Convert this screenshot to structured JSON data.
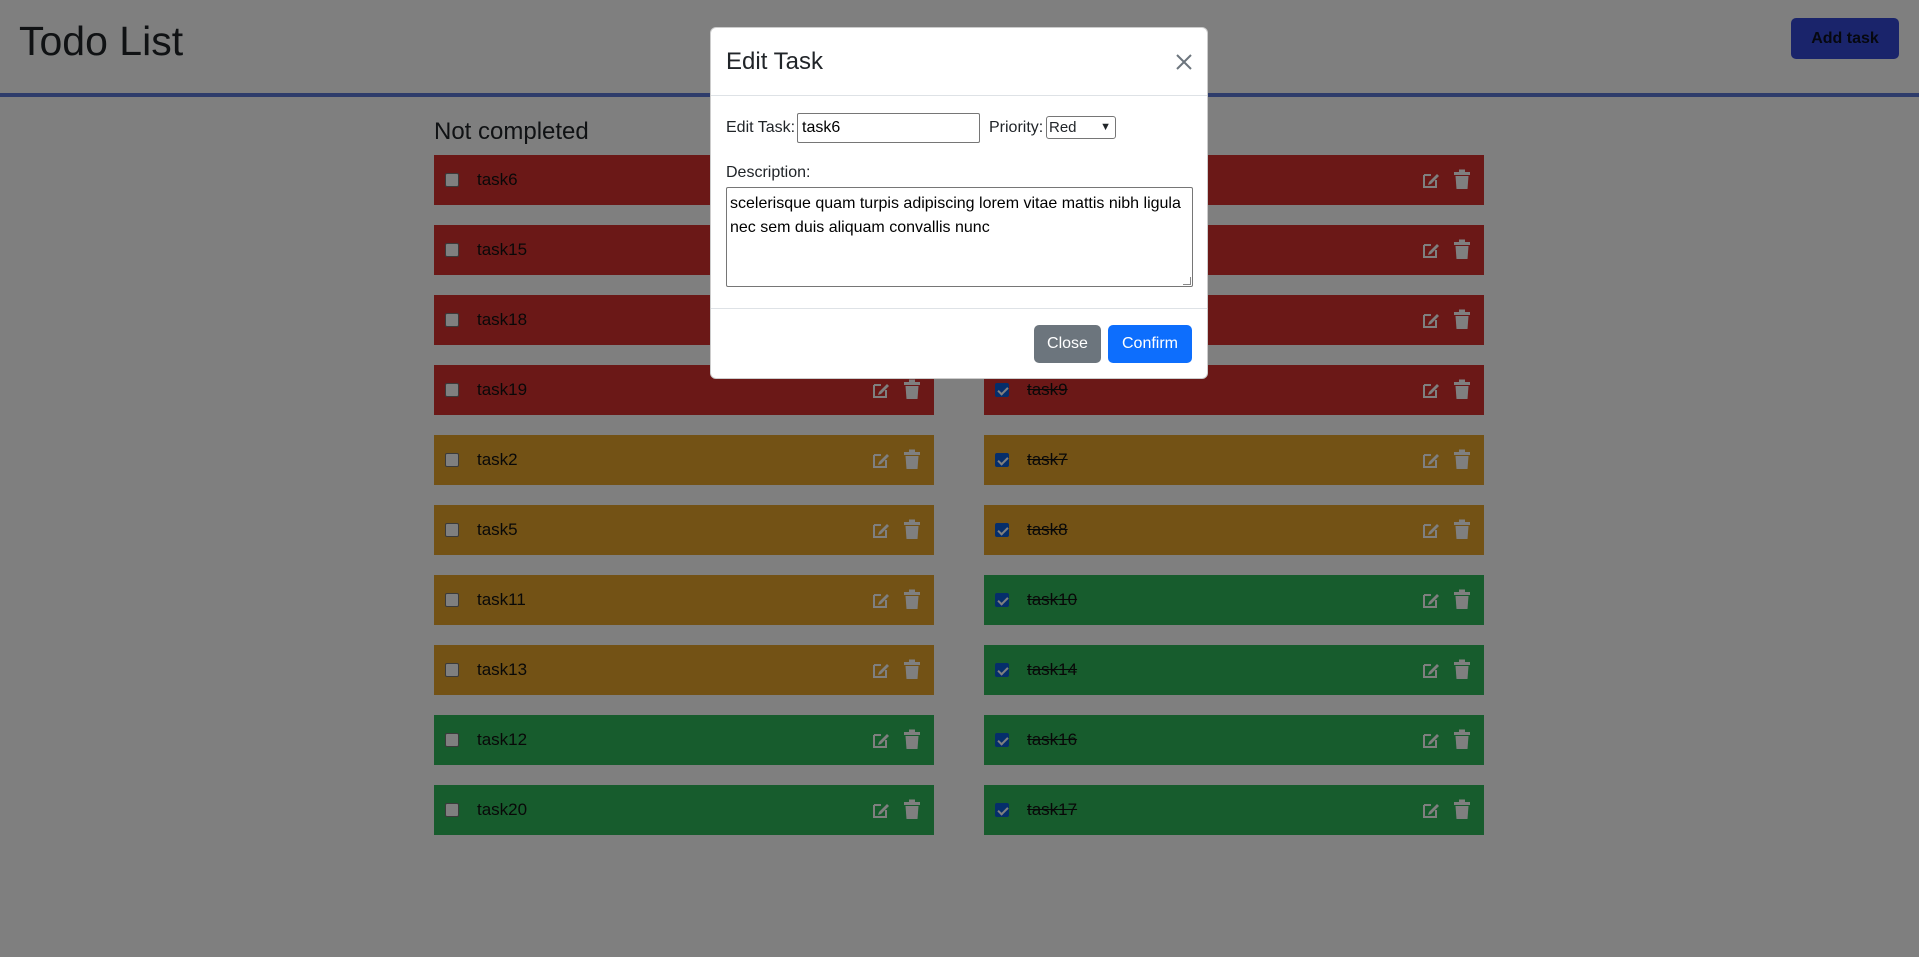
{
  "header": {
    "title": "Todo List",
    "add_button": "Add task"
  },
  "section_title": "Not completed",
  "colors": {
    "red": "#d6312f",
    "yellow": "#e6a52a",
    "green": "#2fb85a",
    "accent": "#0d6efd"
  },
  "not_completed": [
    {
      "name": "task6",
      "priority": "red",
      "done": false
    },
    {
      "name": "task15",
      "priority": "red",
      "done": false
    },
    {
      "name": "task18",
      "priority": "red",
      "done": false
    },
    {
      "name": "task19",
      "priority": "red",
      "done": false
    },
    {
      "name": "task2",
      "priority": "yellow",
      "done": false
    },
    {
      "name": "task5",
      "priority": "yellow",
      "done": false
    },
    {
      "name": "task11",
      "priority": "yellow",
      "done": false
    },
    {
      "name": "task13",
      "priority": "yellow",
      "done": false
    },
    {
      "name": "task12",
      "priority": "green",
      "done": false
    },
    {
      "name": "task20",
      "priority": "green",
      "done": false
    }
  ],
  "completed": [
    {
      "name": "",
      "priority": "red",
      "done": true
    },
    {
      "name": "",
      "priority": "red",
      "done": true
    },
    {
      "name": "",
      "priority": "red",
      "done": true
    },
    {
      "name": "task9",
      "priority": "red",
      "done": true
    },
    {
      "name": "task7",
      "priority": "yellow",
      "done": true
    },
    {
      "name": "task8",
      "priority": "yellow",
      "done": true
    },
    {
      "name": "task10",
      "priority": "green",
      "done": true
    },
    {
      "name": "task14",
      "priority": "green",
      "done": true
    },
    {
      "name": "task16",
      "priority": "green",
      "done": true
    },
    {
      "name": "task17",
      "priority": "green",
      "done": true
    }
  ],
  "icons": {
    "edit": "edit-icon",
    "delete": "trash-icon",
    "close": "close-icon"
  },
  "modal": {
    "title": "Edit Task",
    "edit_label": "Edit Task:",
    "task_value": "task6",
    "priority_label": "Priority:",
    "priority_value": "Red",
    "description_label": "Description:",
    "description_value": "scelerisque quam turpis adipiscing lorem vitae mattis nibh ligula nec sem duis aliquam convallis nunc",
    "close_button": "Close",
    "confirm_button": "Confirm"
  }
}
